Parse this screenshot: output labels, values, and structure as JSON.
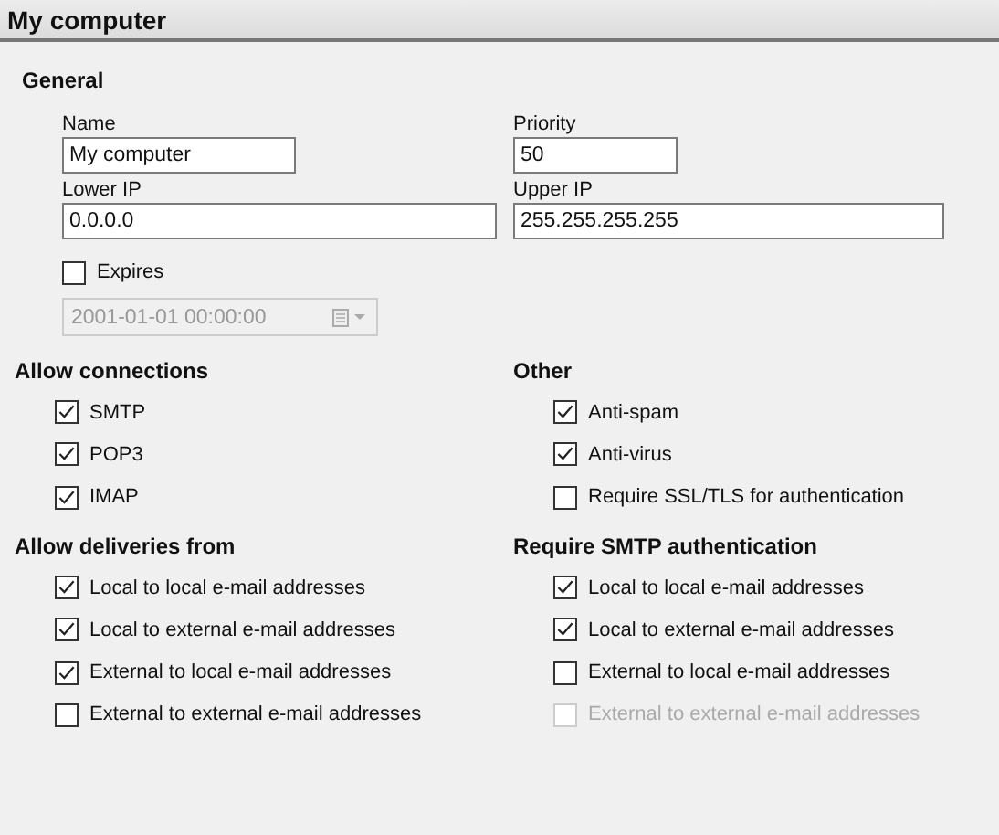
{
  "header": {
    "title": "My computer"
  },
  "general": {
    "title": "General",
    "name": {
      "label": "Name",
      "value": "My computer"
    },
    "priority": {
      "label": "Priority",
      "value": "50"
    },
    "lower_ip": {
      "label": "Lower IP",
      "value": "0.0.0.0"
    },
    "upper_ip": {
      "label": "Upper IP",
      "value": "255.255.255.255"
    },
    "expires": {
      "label": "Expires",
      "checked": false
    },
    "expiry_date": {
      "value": "2001-01-01 00:00:00",
      "disabled": true
    }
  },
  "groups": [
    {
      "title": "Allow connections",
      "options": [
        {
          "label": "SMTP",
          "checked": true,
          "disabled": false
        },
        {
          "label": "POP3",
          "checked": true,
          "disabled": false
        },
        {
          "label": "IMAP",
          "checked": true,
          "disabled": false
        }
      ]
    },
    {
      "title": "Other",
      "options": [
        {
          "label": "Anti-spam",
          "checked": true,
          "disabled": false
        },
        {
          "label": "Anti-virus",
          "checked": true,
          "disabled": false
        },
        {
          "label": "Require SSL/TLS for authentication",
          "checked": false,
          "disabled": false
        }
      ]
    },
    {
      "title": "Allow deliveries from",
      "options": [
        {
          "label": "Local to local e-mail addresses",
          "checked": true,
          "disabled": false
        },
        {
          "label": "Local to external e-mail addresses",
          "checked": true,
          "disabled": false
        },
        {
          "label": "External to local e-mail addresses",
          "checked": true,
          "disabled": false
        },
        {
          "label": "External to external e-mail addresses",
          "checked": false,
          "disabled": false
        }
      ]
    },
    {
      "title": "Require SMTP authentication",
      "options": [
        {
          "label": "Local to local e-mail addresses",
          "checked": true,
          "disabled": false
        },
        {
          "label": "Local to external e-mail addresses",
          "checked": true,
          "disabled": false
        },
        {
          "label": "External to local e-mail addresses",
          "checked": false,
          "disabled": false
        },
        {
          "label": "External to external e-mail addresses",
          "checked": false,
          "disabled": true
        }
      ]
    }
  ]
}
